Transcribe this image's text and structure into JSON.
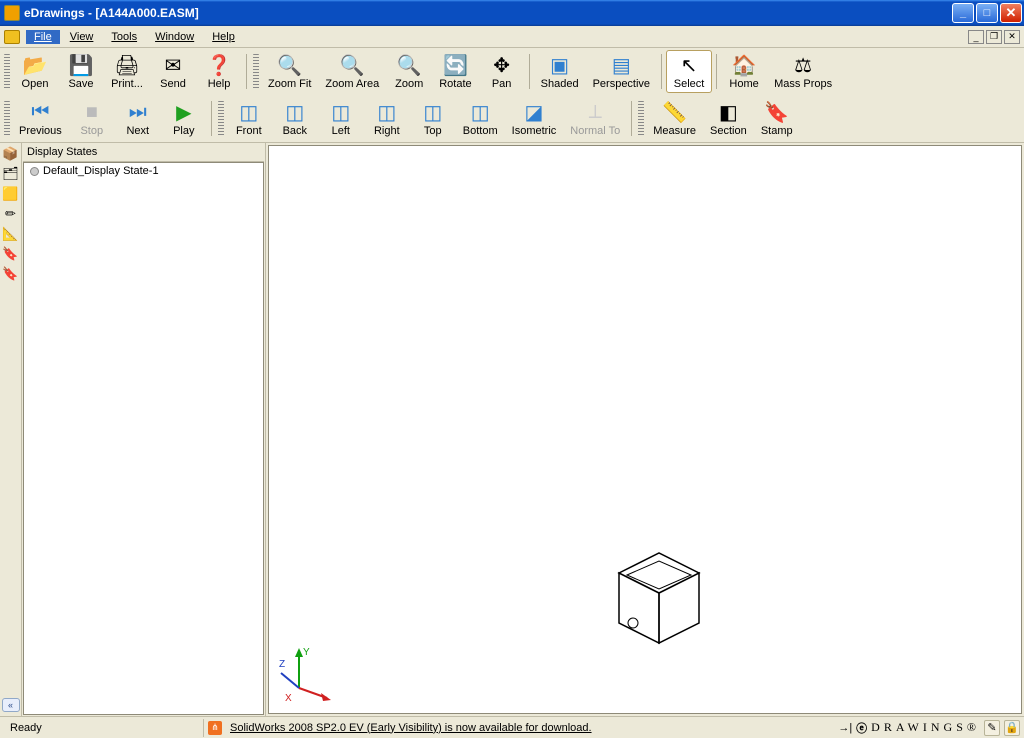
{
  "window": {
    "title": "eDrawings - [A144A000.EASM]"
  },
  "menu": {
    "file": "File",
    "view": "View",
    "tools": "Tools",
    "window": "Window",
    "help": "Help"
  },
  "toolbar": {
    "open": "Open",
    "save": "Save",
    "print": "Print...",
    "send": "Send",
    "help": "Help",
    "zoom_fit": "Zoom Fit",
    "zoom_area": "Zoom Area",
    "zoom": "Zoom",
    "rotate": "Rotate",
    "pan": "Pan",
    "shaded": "Shaded",
    "perspective": "Perspective",
    "select": "Select",
    "home": "Home",
    "mass_props": "Mass Props",
    "previous": "Previous",
    "stop": "Stop",
    "next": "Next",
    "play": "Play",
    "front": "Front",
    "back": "Back",
    "left": "Left",
    "right": "Right",
    "top": "Top",
    "bottom": "Bottom",
    "isometric": "Isometric",
    "normal_to": "Normal To",
    "measure": "Measure",
    "section": "Section",
    "stamp": "Stamp"
  },
  "panel": {
    "header": "Display States",
    "tree_item": "Default_Display State-1"
  },
  "triad": {
    "x": "X",
    "y": "Y",
    "z": "Z"
  },
  "status": {
    "ready": "Ready",
    "news": "SolidWorks 2008 SP2.0 EV (Early Visibility) is now available for download.",
    "brand": "DRAWINGS®"
  },
  "icons": {
    "open": "📂",
    "save": "💾",
    "print": "🖨",
    "send": "✉",
    "help": "❓",
    "zoom_fit": "🔍",
    "zoom_area": "🔍",
    "zoom": "🔍",
    "rotate": "🔄",
    "pan": "✥",
    "shaded": "▣",
    "perspective": "▤",
    "select": "↖",
    "home": "🏠",
    "mass_props": "⚖",
    "previous": "⏮",
    "stop": "■",
    "next": "⏭",
    "play": "▶",
    "front": "◫",
    "back": "◫",
    "left": "◫",
    "right": "◫",
    "top": "◫",
    "bottom": "◫",
    "isometric": "◪",
    "normal_to": "⟂",
    "measure": "📏",
    "section": "◧",
    "stamp": "🔖"
  }
}
